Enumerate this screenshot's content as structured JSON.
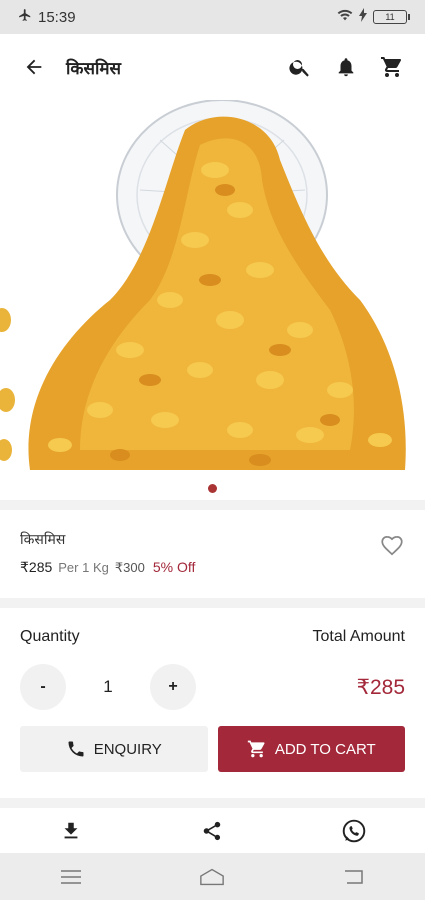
{
  "status": {
    "time": "15:39",
    "battery": "11"
  },
  "header": {
    "title": "किसमिस"
  },
  "carousel": {
    "active_index": 0,
    "count": 1
  },
  "product": {
    "name": "किसमिस",
    "price": "₹285",
    "unit": "Per 1 Kg",
    "mrp": "₹300",
    "discount": "5% Off"
  },
  "quantity": {
    "label": "Quantity",
    "value": "1",
    "minus_label": "-",
    "plus_label": "+",
    "total_label": "Total Amount",
    "total_value": "₹285"
  },
  "buttons": {
    "enquiry": "ENQUIRY",
    "add_to_cart": "ADD TO CART"
  },
  "colors": {
    "accent": "#a3283a",
    "status_bar": "#e6e6e6"
  }
}
